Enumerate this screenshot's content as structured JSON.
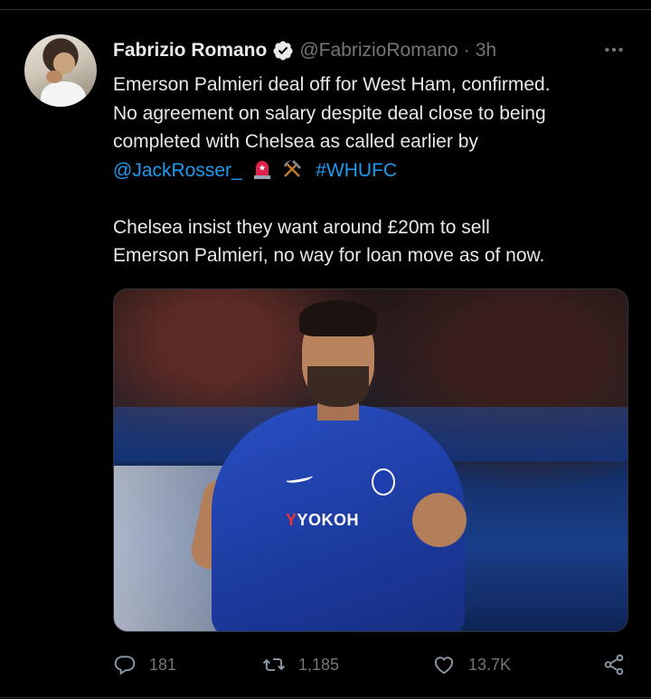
{
  "tweet": {
    "author_name": "Fabrizio Romano",
    "handle": "@FabrizioRomano",
    "separator": "·",
    "time": "3h",
    "lines": [
      "Emerson Palmieri deal off for West Ham, confirmed.",
      "No agreement on salary despite deal close to being",
      "completed with Chelsea as called earlier by"
    ],
    "mention": "@JackRosser_",
    "hashtag": "#WHUFC",
    "emojis": [
      "siren-emoji",
      "hammer-and-pick-emoji"
    ],
    "para2_lines": [
      "Chelsea insist they want around £20m to sell",
      "Emerson Palmieri, no way for loan move as of now."
    ],
    "media": {
      "kind": "photo",
      "sponsor_text_red": "Y",
      "sponsor_text": "YOKOH"
    }
  },
  "actions": {
    "reply_count": "181",
    "retweet_count": "1,185",
    "like_count": "13.7K"
  },
  "icons": {
    "verified": "verified-badge-icon",
    "more": "more-icon",
    "reply": "reply-icon",
    "retweet": "retweet-icon",
    "like": "like-icon",
    "share": "share-icon"
  },
  "colors": {
    "background": "#000000",
    "text": "#e7e9ea",
    "secondary": "#71767b",
    "link": "#1d9bf0"
  }
}
